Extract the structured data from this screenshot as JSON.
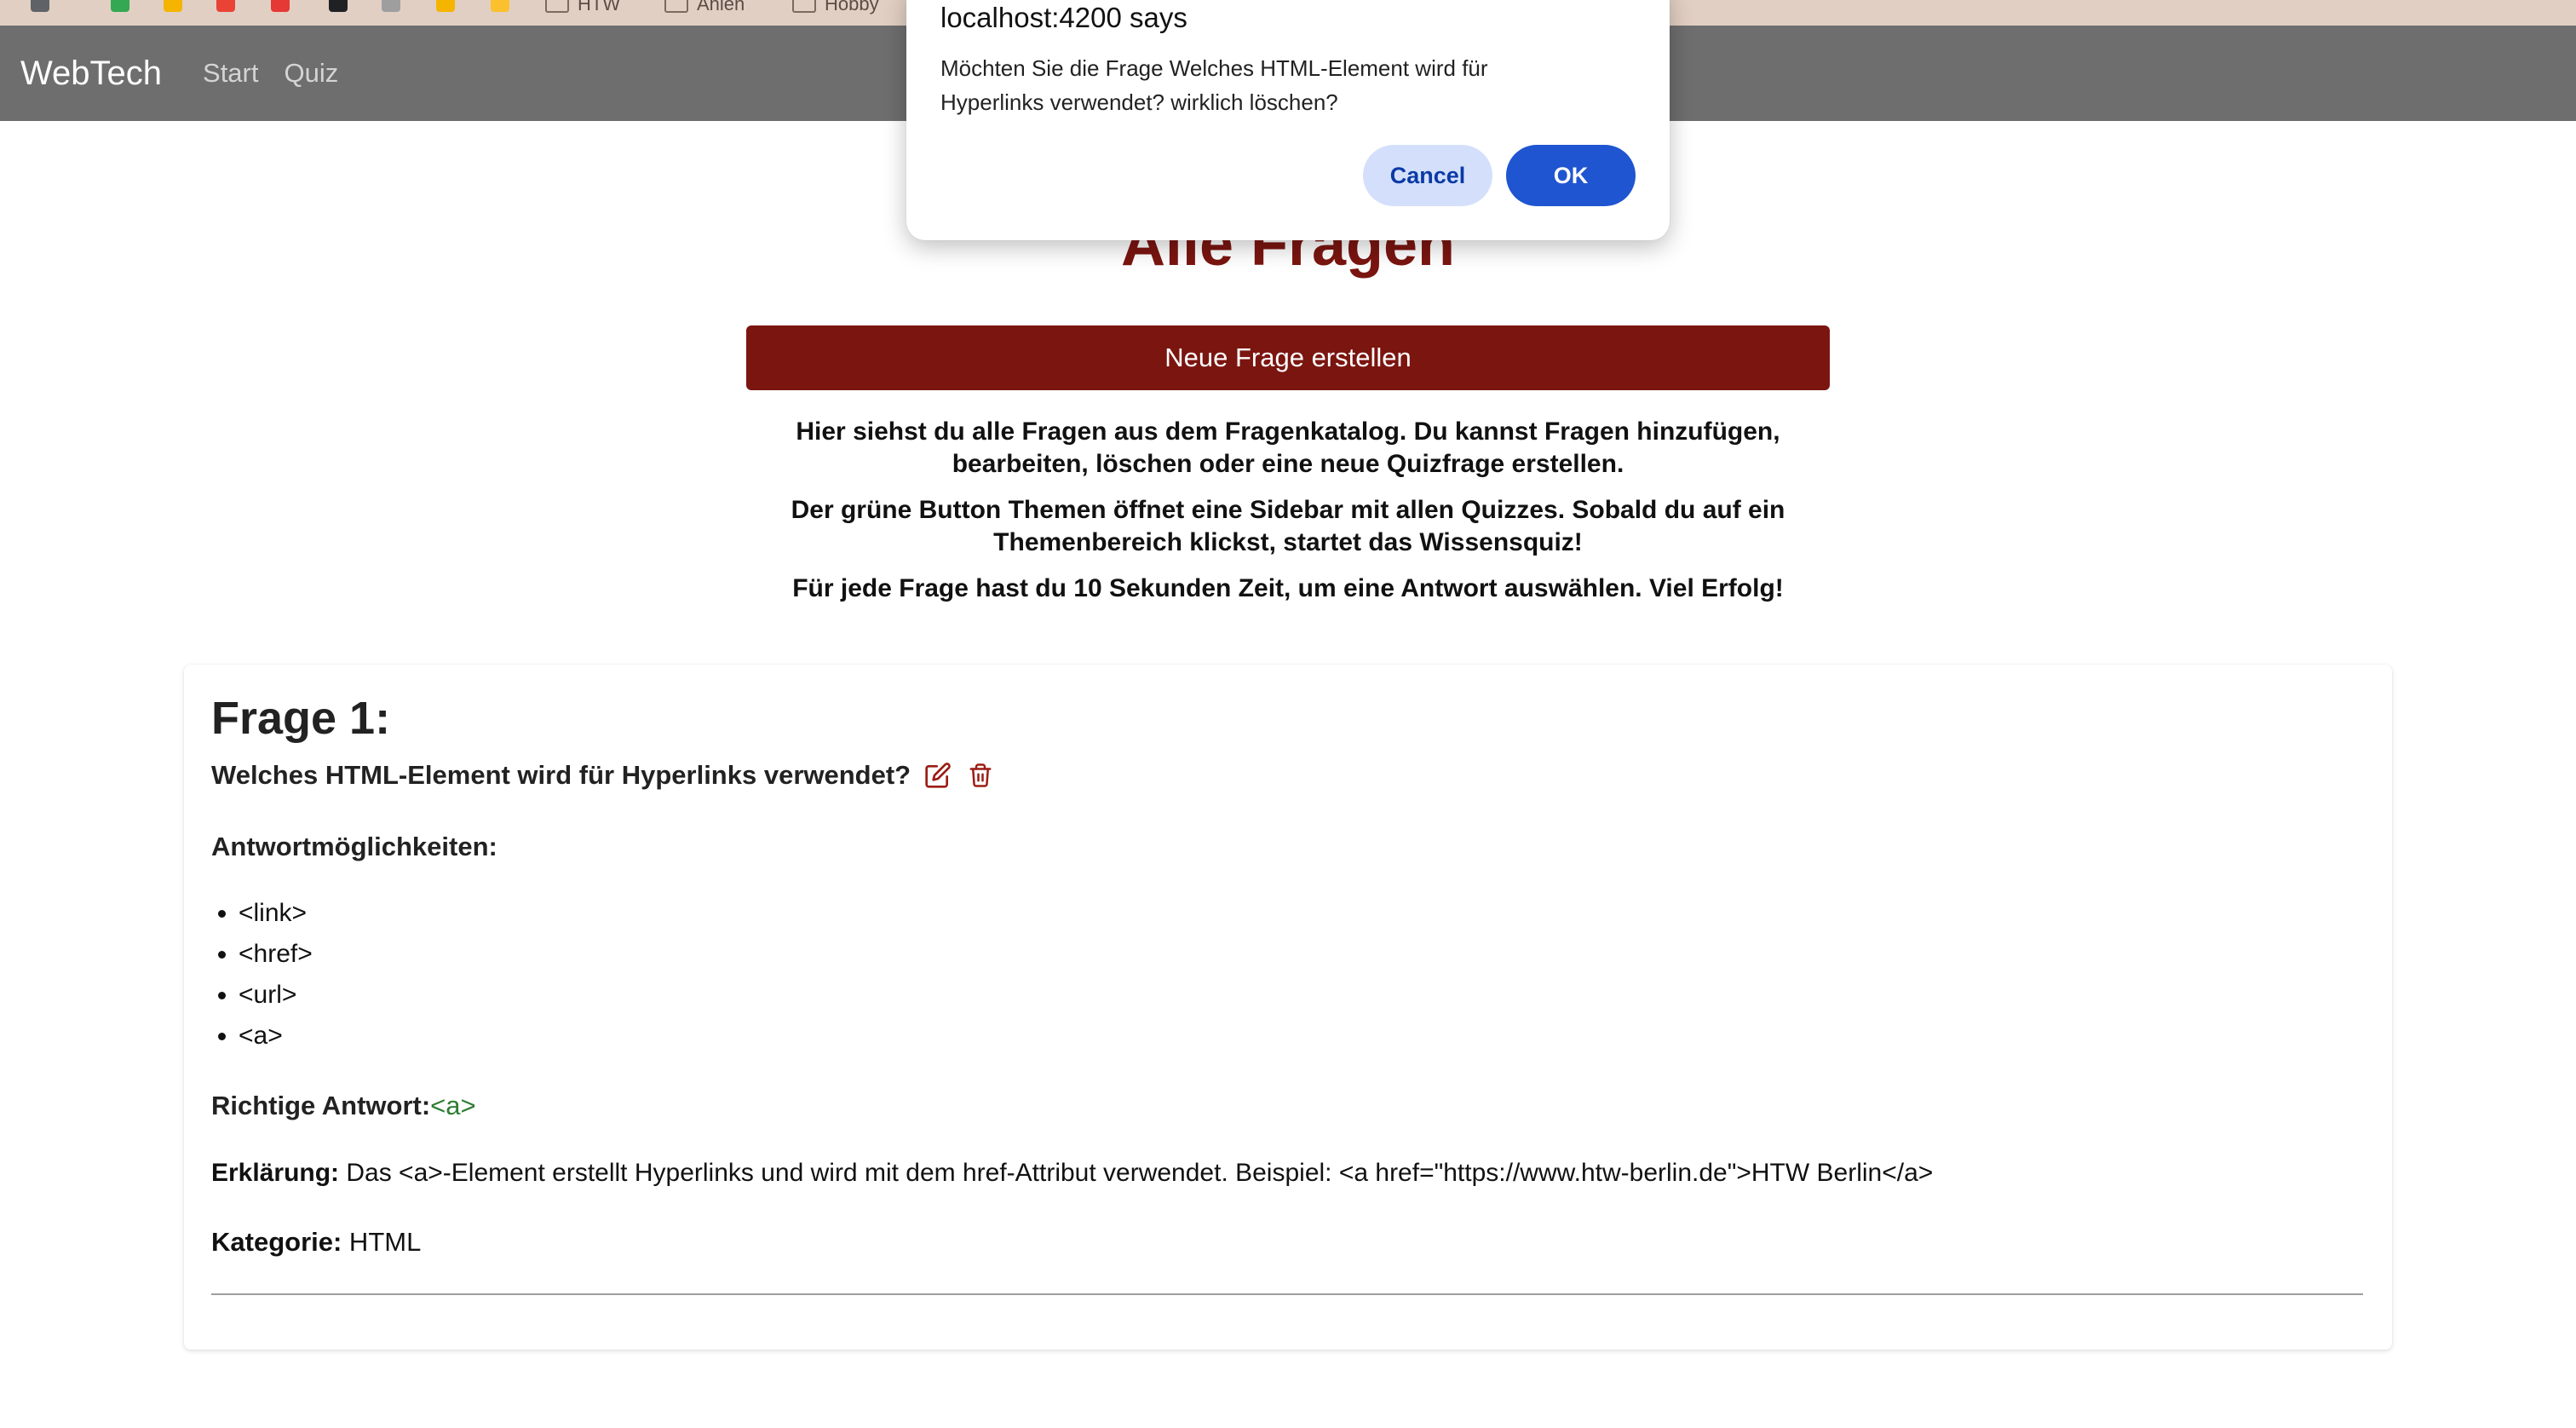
{
  "bookmarks": {
    "folders": [
      "HTW",
      "Ahlen",
      "Hobby"
    ],
    "icon_colors": [
      "#5f6368",
      "#34a853",
      "#f4b400",
      "#ea4335",
      "#e53935",
      "#202124",
      "#9e9e9e",
      "#f4b400",
      "#fbc02d"
    ]
  },
  "navbar": {
    "brand": "WebTech",
    "links": [
      "Start",
      "Quiz"
    ]
  },
  "page": {
    "heading": "Alle Fragen",
    "new_question_button": "Neue Frage erstellen",
    "intro": [
      "Hier siehst du alle Fragen aus dem Fragenkatalog. Du kannst Fragen hinzufügen, bearbeiten, löschen oder eine neue Quizfrage erstellen.",
      "Der grüne Button Themen öffnet eine Sidebar mit allen Quizzes. Sobald du auf ein Themenbereich klickst, startet das Wissensquiz!",
      "Für jede Frage hast du 10 Sekunden Zeit, um eine Antwort auswählen. Viel Erfolg!"
    ]
  },
  "question": {
    "title": "Frage 1:",
    "text": "Welches HTML-Element wird für Hyperlinks verwendet?",
    "edit_icon": "edit-icon",
    "delete_icon": "trash-icon",
    "answers_label": "Antwortmöglichkeiten:",
    "answers": [
      "<link>",
      "<href>",
      "<url>",
      "<a>"
    ],
    "correct_label": "Richtige Antwort:",
    "correct_value": "<a>",
    "explanation_label": "Erklärung:",
    "explanation": " Das <a>-Element erstellt Hyperlinks und wird mit dem href-Attribut verwendet. Beispiel: <a href=\"https://www.htw-berlin.de\">HTW Berlin</a>",
    "category_label": "Kategorie:",
    "category": " HTML"
  },
  "dialog": {
    "title": "localhost:4200 says",
    "message": "Möchten Sie die Frage Welches HTML-Element wird für Hyperlinks verwendet? wirklich löschen?",
    "cancel_label": "Cancel",
    "ok_label": "OK"
  },
  "colors": {
    "brand_red": "#7b1510",
    "navbar": "#6e6e6e",
    "correct_green": "#2e7d32",
    "dialog_ok": "#1f55d0",
    "dialog_cancel": "#d4e0fb"
  }
}
